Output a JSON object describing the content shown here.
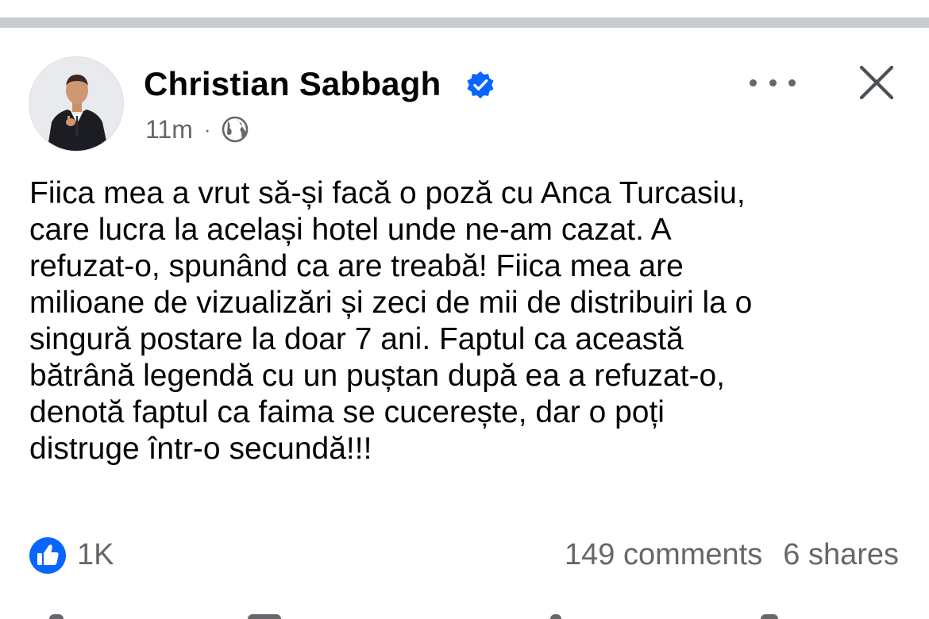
{
  "post": {
    "author": "Christian Sabbagh",
    "verified": true,
    "time": "11m",
    "audience_icon": "globe-icon",
    "separator": "·",
    "body_lines": [
      "Fiica mea a vrut să-și facă o poză cu Anca Turcasiu,",
      "care lucra la același hotel unde ne-am cazat. A",
      "refuzat-o, spunând ca are treabă! Fiica mea are",
      "milioane de vizualizări și zeci de mii de distribuiri la o",
      "singură postare la doar 7 ani. Faptul ca această",
      "bătrână legendă cu un puștan după ea a refuzat-o,",
      "denotă faptul ca faima se cucerește, dar o poți",
      "distruge într-o secundă!!!"
    ],
    "reactions": {
      "icon": "like-icon",
      "count": "1K"
    },
    "comments": "149 comments",
    "shares": "6 shares"
  },
  "header_actions": {
    "more_icon": "more-icon",
    "close_icon": "close-icon"
  },
  "colors": {
    "accent": "#0866ff",
    "secondary_text": "#65676b",
    "divider": "#c9ccd1"
  }
}
